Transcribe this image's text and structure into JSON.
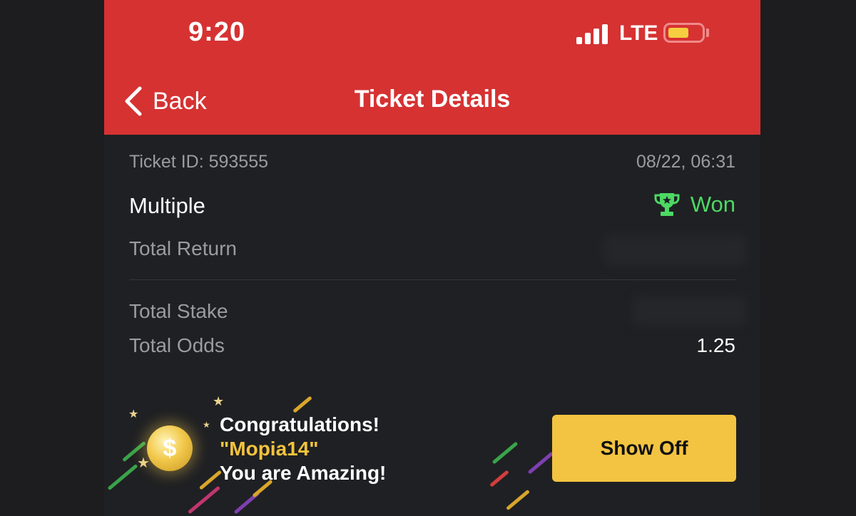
{
  "status_bar": {
    "time": "9:20",
    "network": "LTE"
  },
  "nav": {
    "back_label": "Back",
    "title": "Ticket Details"
  },
  "ticket": {
    "id_label": "Ticket ID: 593555",
    "date": "08/22, 06:31",
    "bet_type": "Multiple",
    "status": "Won",
    "total_return_label": "Total Return",
    "total_stake_label": "Total Stake",
    "total_odds_label": "Total Odds",
    "total_odds_value": "1.25"
  },
  "banner": {
    "line1": "Congratulations!",
    "username": "\"Mopia14\"",
    "line3": "You are Amazing!",
    "button_label": "Show Off",
    "coin_symbol": "$"
  },
  "colors": {
    "header_bg": "#d63232",
    "won_green": "#4cd964",
    "button_yellow": "#f3c441",
    "background": "#1f2023"
  },
  "icons": {
    "back": "chevron-left-icon",
    "won": "trophy-icon",
    "signal": "signal-bars-icon",
    "battery": "battery-icon",
    "coin": "coin-icon"
  }
}
